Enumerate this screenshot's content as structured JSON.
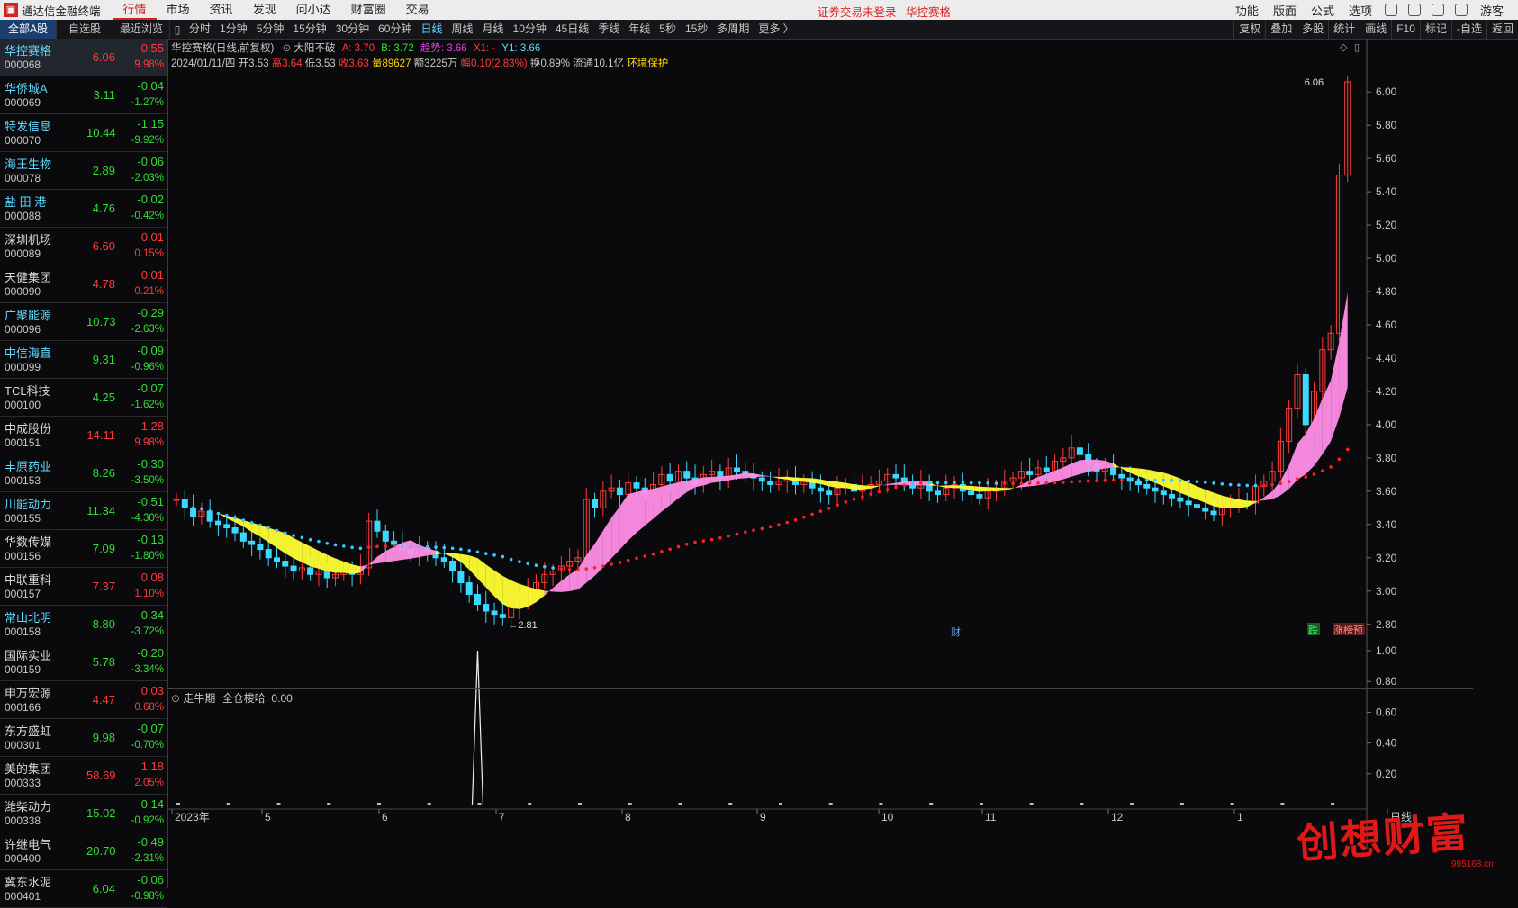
{
  "app": {
    "title": "通达信金融终端",
    "notice": "证券交易未登录",
    "stock_link": "华控赛格"
  },
  "menu": [
    "行情",
    "市场",
    "资讯",
    "发现",
    "问小达",
    "财富圈",
    "交易"
  ],
  "topright": [
    "功能",
    "版面",
    "公式",
    "选项",
    "游客"
  ],
  "left_tabs": [
    "全部A股",
    "自选股",
    "最近浏览"
  ],
  "periods": [
    "分时",
    "1分钟",
    "5分钟",
    "15分钟",
    "30分钟",
    "60分钟",
    "日线",
    "周线",
    "月线",
    "10分钟",
    "45日线",
    "季线",
    "年线",
    "5秒",
    "15秒",
    "多周期",
    "更多 〉"
  ],
  "right_tools": [
    "复权",
    "叠加",
    "多股",
    "统计",
    "画线",
    "F10",
    "标记",
    "-自选",
    "返回"
  ],
  "stocks": [
    {
      "name": "华控赛格",
      "code": "000068",
      "price": "6.06",
      "chg": "0.55",
      "pct": "9.98%",
      "dir": "up",
      "nc": "cyan"
    },
    {
      "name": "华侨城A",
      "code": "000069",
      "price": "3.11",
      "chg": "-0.04",
      "pct": "-1.27%",
      "dir": "down",
      "nc": "cyan"
    },
    {
      "name": "特发信息",
      "code": "000070",
      "price": "10.44",
      "chg": "-1.15",
      "pct": "-9.92%",
      "dir": "down",
      "nc": "cyan"
    },
    {
      "name": "海王生物",
      "code": "000078",
      "price": "2.89",
      "chg": "-0.06",
      "pct": "-2.03%",
      "dir": "down",
      "nc": "cyan"
    },
    {
      "name": "盐 田 港",
      "code": "000088",
      "price": "4.76",
      "chg": "-0.02",
      "pct": "-0.42%",
      "dir": "down",
      "nc": "cyan"
    },
    {
      "name": "深圳机场",
      "code": "000089",
      "price": "6.60",
      "chg": "0.01",
      "pct": "0.15%",
      "dir": "up",
      "nc": "white"
    },
    {
      "name": "天健集团",
      "code": "000090",
      "price": "4.78",
      "chg": "0.01",
      "pct": "0.21%",
      "dir": "up",
      "nc": "white"
    },
    {
      "name": "广聚能源",
      "code": "000096",
      "price": "10.73",
      "chg": "-0.29",
      "pct": "-2.63%",
      "dir": "down",
      "nc": "cyan"
    },
    {
      "name": "中信海直",
      "code": "000099",
      "price": "9.31",
      "chg": "-0.09",
      "pct": "-0.96%",
      "dir": "down",
      "nc": "cyan"
    },
    {
      "name": "TCL科技",
      "code": "000100",
      "price": "4.25",
      "chg": "-0.07",
      "pct": "-1.62%",
      "dir": "down",
      "nc": "white"
    },
    {
      "name": "中成股份",
      "code": "000151",
      "price": "14.11",
      "chg": "1.28",
      "pct": "9.98%",
      "dir": "up",
      "nc": "white"
    },
    {
      "name": "丰原药业",
      "code": "000153",
      "price": "8.26",
      "chg": "-0.30",
      "pct": "-3.50%",
      "dir": "down",
      "nc": "cyan"
    },
    {
      "name": "川能动力",
      "code": "000155",
      "price": "11.34",
      "chg": "-0.51",
      "pct": "-4.30%",
      "dir": "down",
      "nc": "cyan"
    },
    {
      "name": "华数传媒",
      "code": "000156",
      "price": "7.09",
      "chg": "-0.13",
      "pct": "-1.80%",
      "dir": "down",
      "nc": "white"
    },
    {
      "name": "中联重科",
      "code": "000157",
      "price": "7.37",
      "chg": "0.08",
      "pct": "1.10%",
      "dir": "up",
      "nc": "white"
    },
    {
      "name": "常山北明",
      "code": "000158",
      "price": "8.80",
      "chg": "-0.34",
      "pct": "-3.72%",
      "dir": "down",
      "nc": "cyan"
    },
    {
      "name": "国际实业",
      "code": "000159",
      "price": "5.78",
      "chg": "-0.20",
      "pct": "-3.34%",
      "dir": "down",
      "nc": "white"
    },
    {
      "name": "申万宏源",
      "code": "000166",
      "price": "4.47",
      "chg": "0.03",
      "pct": "0.68%",
      "dir": "up",
      "nc": "white"
    },
    {
      "name": "东方盛虹",
      "code": "000301",
      "price": "9.98",
      "chg": "-0.07",
      "pct": "-0.70%",
      "dir": "down",
      "nc": "white"
    },
    {
      "name": "美的集团",
      "code": "000333",
      "price": "58.69",
      "chg": "1.18",
      "pct": "2.05%",
      "dir": "up",
      "nc": "white"
    },
    {
      "name": "潍柴动力",
      "code": "000338",
      "price": "15.02",
      "chg": "-0.14",
      "pct": "-0.92%",
      "dir": "down",
      "nc": "white"
    },
    {
      "name": "许继电气",
      "code": "000400",
      "price": "20.70",
      "chg": "-0.49",
      "pct": "-2.31%",
      "dir": "down",
      "nc": "white"
    },
    {
      "name": "冀东水泥",
      "code": "000401",
      "price": "6.04",
      "chg": "-0.06",
      "pct": "-0.98%",
      "dir": "down",
      "nc": "white"
    }
  ],
  "chart_header": {
    "title": "华控赛格(日线,前复权)",
    "indicator": "大阳不破",
    "a": "A: 3.70",
    "b": "B: 3.72",
    "trend": "趋势: 3.66",
    "x1": "X1: -",
    "y1": "Y1: 3.66"
  },
  "ohlc_line": {
    "date": "2024/01/11/四",
    "open": "开3.53",
    "high": "高3.64",
    "low": "低3.53",
    "close": "收3.63",
    "vol": "量89627",
    "amount": "额3225万",
    "range": "幅0.10(2.83%)",
    "turnover": "换0.89%",
    "float": "流通10.1亿",
    "sector": "环境保护"
  },
  "chart_data": {
    "type": "candlestick",
    "title": "华控赛格(日线,前复权)",
    "y_ticks": [
      "6.00",
      "5.80",
      "5.60",
      "5.40",
      "5.20",
      "5.00",
      "4.80",
      "4.60",
      "4.40",
      "4.20",
      "4.00",
      "3.80",
      "3.60",
      "3.40",
      "3.20",
      "3.00",
      "2.80"
    ],
    "ylim": [
      2.75,
      6.12
    ],
    "x_ticks": [
      "2023年",
      "5",
      "6",
      "7",
      "8",
      "9",
      "10",
      "11",
      "12",
      "1",
      "日线"
    ],
    "annotations": {
      "high_label": "6.06",
      "low_label": "2.81",
      "fin_marker": "财",
      "down_tag": "跌",
      "limit_tag": "涨榜预"
    },
    "closes": [
      3.55,
      3.5,
      3.45,
      3.48,
      3.42,
      3.4,
      3.38,
      3.35,
      3.3,
      3.28,
      3.25,
      3.2,
      3.18,
      3.15,
      3.12,
      3.14,
      3.1,
      3.12,
      3.08,
      3.1,
      3.12,
      3.1,
      3.14,
      3.42,
      3.36,
      3.3,
      3.28,
      3.25,
      3.22,
      3.26,
      3.24,
      3.2,
      3.18,
      3.12,
      3.05,
      2.98,
      2.92,
      2.88,
      2.86,
      2.84,
      2.9,
      2.95,
      3.0,
      3.05,
      3.1,
      3.12,
      3.15,
      3.18,
      3.2,
      3.55,
      3.5,
      3.6,
      3.62,
      3.58,
      3.65,
      3.62,
      3.58,
      3.64,
      3.7,
      3.66,
      3.72,
      3.68,
      3.64,
      3.7,
      3.72,
      3.68,
      3.74,
      3.72,
      3.7,
      3.68,
      3.66,
      3.64,
      3.66,
      3.68,
      3.64,
      3.66,
      3.62,
      3.6,
      3.58,
      3.62,
      3.64,
      3.6,
      3.62,
      3.64,
      3.66,
      3.7,
      3.68,
      3.65,
      3.62,
      3.66,
      3.6,
      3.58,
      3.62,
      3.64,
      3.6,
      3.58,
      3.56,
      3.6,
      3.62,
      3.66,
      3.68,
      3.72,
      3.7,
      3.74,
      3.72,
      3.78,
      3.8,
      3.86,
      3.82,
      3.76,
      3.72,
      3.74,
      3.7,
      3.68,
      3.66,
      3.64,
      3.62,
      3.6,
      3.58,
      3.56,
      3.54,
      3.52,
      3.5,
      3.48,
      3.46,
      3.5,
      3.52,
      3.54,
      3.53,
      3.63,
      3.66,
      3.72,
      3.9,
      4.1,
      4.3,
      4.0,
      4.2,
      4.45,
      4.55,
      5.5,
      6.06
    ],
    "indicator": {
      "name": "走牛期",
      "label": "全仓梭哈: 0.00",
      "y_ticks": [
        "1.00",
        "0.80",
        "0.60",
        "0.40",
        "0.20"
      ],
      "ylim": [
        0,
        1
      ],
      "spike_value": 1.0
    }
  }
}
